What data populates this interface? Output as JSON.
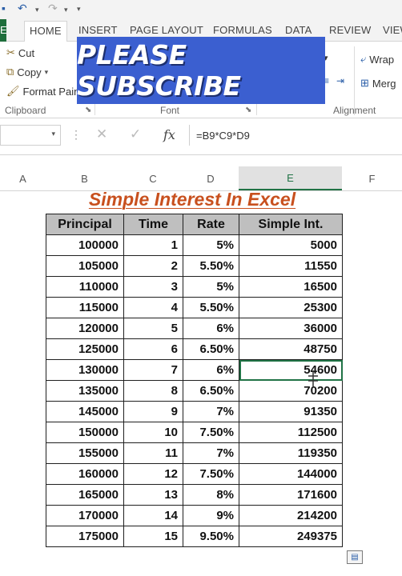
{
  "quick_access": {
    "undo_icon": "undo-icon",
    "redo_icon": "redo-icon"
  },
  "tabs": [
    {
      "label": "E"
    },
    {
      "label": "HOME"
    },
    {
      "label": "INSERT"
    },
    {
      "label": "PAGE LAYOUT"
    },
    {
      "label": "FORMULAS"
    },
    {
      "label": "DATA"
    },
    {
      "label": "REVIEW"
    },
    {
      "label": "VIEW"
    }
  ],
  "ribbon": {
    "clipboard": {
      "cut": "Cut",
      "copy": "Copy",
      "format_painter": "Format Pain",
      "group": "Clipboard"
    },
    "font": {
      "group": "Font"
    },
    "alignment": {
      "wrap": "Wrap",
      "merge": "Merg",
      "group": "Alignment"
    }
  },
  "banner": {
    "text": "PLEASE SUBSCRIBE",
    "color": "#3b5fd0"
  },
  "formula_bar": {
    "name_box": "",
    "fx": "fx",
    "formula": "=B9*C9*D9"
  },
  "columns": [
    "A",
    "B",
    "C",
    "D",
    "E",
    "F"
  ],
  "sheet": {
    "title": "Simple Interest In Excel",
    "headers": [
      "Principal",
      "Time",
      "Rate",
      "Simple Int."
    ],
    "rows": [
      [
        "100000",
        "1",
        "5%",
        "5000"
      ],
      [
        "105000",
        "2",
        "5.50%",
        "11550"
      ],
      [
        "110000",
        "3",
        "5%",
        "16500"
      ],
      [
        "115000",
        "4",
        "5.50%",
        "25300"
      ],
      [
        "120000",
        "5",
        "6%",
        "36000"
      ],
      [
        "125000",
        "6",
        "6.50%",
        "48750"
      ],
      [
        "130000",
        "7",
        "6%",
        "54600"
      ],
      [
        "135000",
        "8",
        "6.50%",
        "70200"
      ],
      [
        "145000",
        "9",
        "7%",
        "91350"
      ],
      [
        "150000",
        "10",
        "7.50%",
        "112500"
      ],
      [
        "155000",
        "11",
        "7%",
        "119350"
      ],
      [
        "160000",
        "12",
        "7.50%",
        "144000"
      ],
      [
        "165000",
        "13",
        "8%",
        "171600"
      ],
      [
        "170000",
        "14",
        "9%",
        "214200"
      ],
      [
        "175000",
        "15",
        "9.50%",
        "249375"
      ]
    ]
  },
  "colors": {
    "accent": "#217346",
    "title": "#c8501e",
    "header_fill": "#bfbfbf"
  }
}
